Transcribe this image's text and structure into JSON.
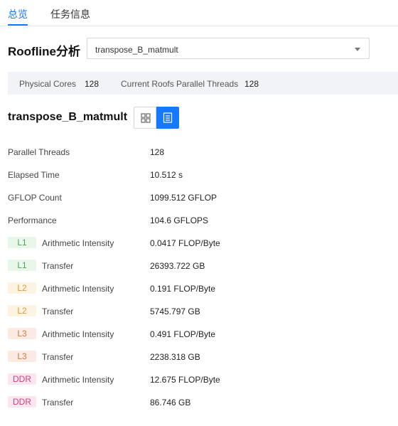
{
  "tabs": [
    {
      "label": "总览",
      "active": true
    },
    {
      "label": "任务信息",
      "active": false
    }
  ],
  "roofline": {
    "title": "Roofline分析",
    "select_value": "transpose_B_matmult"
  },
  "info": {
    "physical_cores_label": "Physical Cores",
    "physical_cores_value": "128",
    "parallel_threads_label": "Current Roofs Parallel Threads",
    "parallel_threads_value": "128"
  },
  "section": {
    "title": "transpose_B_matmult",
    "view_icons": [
      "grid-view-icon",
      "list-view-icon"
    ]
  },
  "metrics": [
    {
      "label": "Parallel Threads",
      "value": "128"
    },
    {
      "label": "Elapsed Time",
      "value": "10.512 s"
    },
    {
      "label": "GFLOP Count",
      "value": "1099.512 GFLOP"
    },
    {
      "label": "Performance",
      "value": "104.6 GFLOPS"
    }
  ],
  "cache_metrics": [
    {
      "badge": "L1",
      "label": "Arithmetic Intensity",
      "value": "0.0417 FLOP/Byte"
    },
    {
      "badge": "L1",
      "label": "Transfer",
      "value": "26393.722 GB"
    },
    {
      "badge": "L2",
      "label": "Arithmetic Intensity",
      "value": "0.191 FLOP/Byte"
    },
    {
      "badge": "L2",
      "label": "Transfer",
      "value": "5745.797 GB"
    },
    {
      "badge": "L3",
      "label": "Arithmetic Intensity",
      "value": "0.491 FLOP/Byte"
    },
    {
      "badge": "L3",
      "label": "Transfer",
      "value": "2238.318 GB"
    },
    {
      "badge": "DDR",
      "label": "Arithmetic Intensity",
      "value": "12.675 FLOP/Byte"
    },
    {
      "badge": "DDR",
      "label": "Transfer",
      "value": "86.746 GB"
    }
  ],
  "colors": {
    "accent": "#1677ff",
    "L1": {
      "bg": "#e8f7ea",
      "fg": "#48a85a"
    },
    "L2": {
      "bg": "#fdf3e3",
      "fg": "#e09a3a"
    },
    "L3": {
      "bg": "#fbeae1",
      "fg": "#d9793f"
    },
    "DDR": {
      "bg": "#fbe6ef",
      "fg": "#c9457c"
    }
  }
}
